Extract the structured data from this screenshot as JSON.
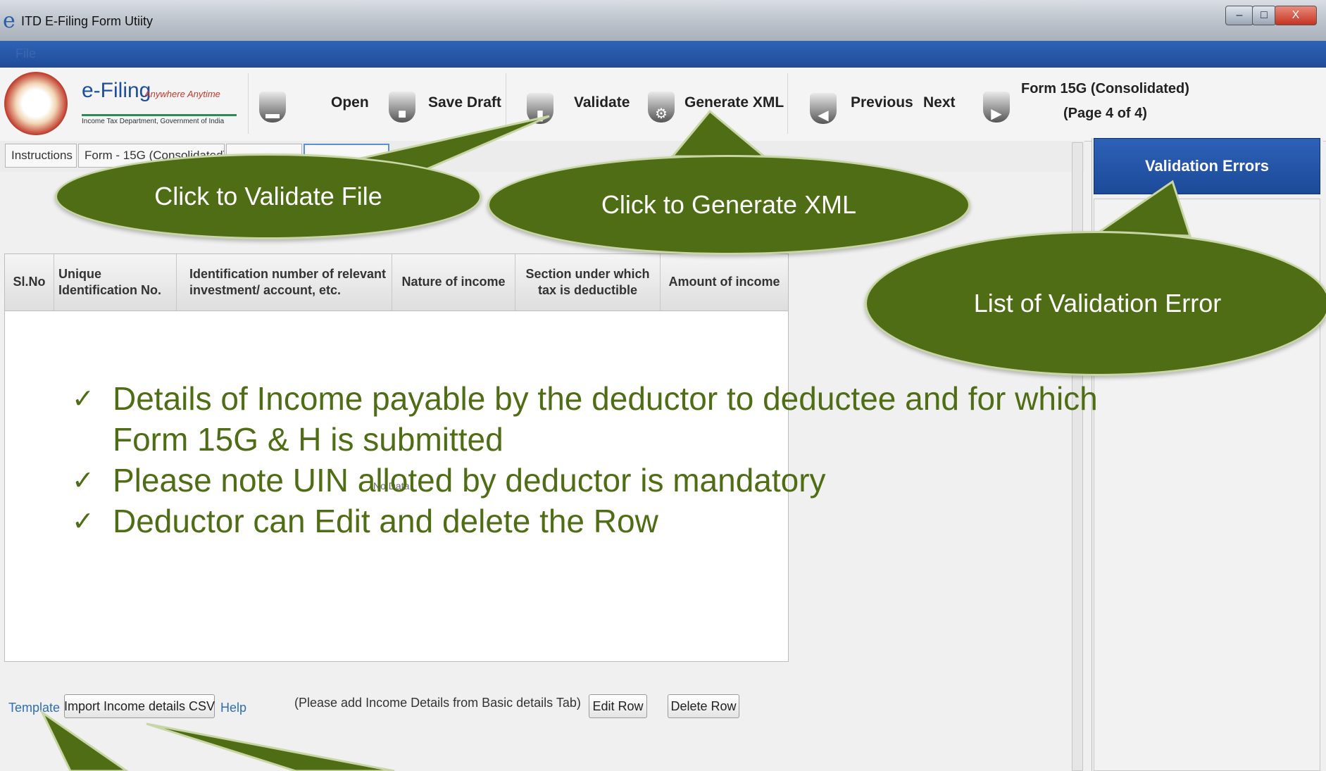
{
  "window": {
    "title": "ITD E-Filing Form Utiity",
    "minimize": "–",
    "maximize": "□",
    "close": "X"
  },
  "menu": {
    "file": "File"
  },
  "logo": {
    "name": "e-Filing",
    "tagline": "Anywhere Anytime",
    "subtitle": "Income Tax Department, Government of India"
  },
  "toolbar": {
    "open": "Open",
    "save_draft": "Save Draft",
    "validate": "Validate",
    "generate_xml": "Generate XML",
    "previous": "Previous",
    "next": "Next",
    "form_title": "Form 15G (Consolidated)",
    "page_info": "(Page 4 of 4)"
  },
  "tabs": [
    {
      "label": "Instructions"
    },
    {
      "label": "Form - 15G (Consolidated)"
    },
    {
      "label": ""
    },
    {
      "label": ""
    }
  ],
  "right_panel": {
    "header": "Validation Errors"
  },
  "table": {
    "headers": [
      "Sl.No",
      "Unique Identification No.",
      "Identification number of relevant investment/ account, etc.",
      "Nature of income",
      "Section under which tax is deductible",
      "Amount of income"
    ],
    "empty_text": "No Data"
  },
  "bottom": {
    "template_link": "Template",
    "import_button": "Import Income details CSV",
    "help_link": "Help",
    "hint": "(Please add Income Details from Basic details Tab)",
    "edit_row": "Edit Row",
    "delete_row": "Delete Row"
  },
  "callouts": {
    "validate": "Click to  Validate File",
    "generate": "Click to  Generate XML",
    "errors": "List of Validation Error"
  },
  "bullets": {
    "check_mark": "✓",
    "item1_line1": "Details of Income payable by the deductor  to deductee and for which",
    "item1_line2": "Form 15G & H is submitted",
    "item2": "Please note UIN alloted by deductor is mandatory",
    "item3": "Deductor can Edit and delete the Row"
  },
  "colors": {
    "callout_green": "#4e6d14",
    "bullet_green": "#4e6d14",
    "menubar_blue": "#2a5cae",
    "panel_header_blue": "#2458ac"
  },
  "icons": [
    "e-logo-icon",
    "folder-icon",
    "save-icon",
    "document-icon",
    "gear-icon",
    "arrow-left-icon",
    "arrow-right-icon"
  ]
}
